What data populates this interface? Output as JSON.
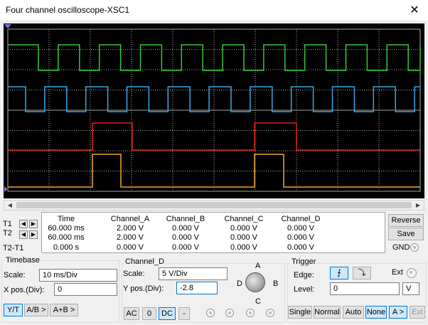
{
  "window": {
    "title": "Four channel oscilloscope-XSC1",
    "close_glyph": "✕"
  },
  "colors": {
    "ch_a": "#38c838",
    "ch_b": "#38a8e8",
    "ch_c": "#e82020",
    "ch_d": "#f0a830",
    "grid": "#dcdcdc"
  },
  "readout": {
    "headers": [
      "Time",
      "Channel_A",
      "Channel_B",
      "Channel_C",
      "Channel_D"
    ],
    "rows": [
      {
        "label": "T1",
        "time": "60.000 ms",
        "a": "2.000 V",
        "b": "0.000 V",
        "c": "0.000 V",
        "d": "0.000 V"
      },
      {
        "label": "T2",
        "time": "60.000 ms",
        "a": "2.000 V",
        "b": "0.000 V",
        "c": "0.000 V",
        "d": "0.000 V"
      },
      {
        "label": "T2-T1",
        "time": "0.000 s",
        "a": "0.000 V",
        "b": "0.000 V",
        "c": "0.000 V",
        "d": "0.000 V"
      }
    ]
  },
  "side": {
    "reverse": "Reverse",
    "save": "Save",
    "gnd": "GND"
  },
  "timebase": {
    "title": "Timebase",
    "scale_label": "Scale:",
    "scale_value": "10 ms/Div",
    "xpos_label": "X pos.(Div):",
    "xpos_value": "0",
    "modes": [
      "Y/T",
      "A/B >",
      "A+B >"
    ]
  },
  "channel": {
    "title": "Channel_D",
    "scale_label": "Scale:",
    "scale_value": "5  V/Div",
    "ypos_label": "Y pos.(Div):",
    "ypos_value": "-2.8",
    "coupling": [
      "AC",
      "0",
      "DC",
      "-"
    ],
    "knob_labels": {
      "a": "A",
      "b": "B",
      "c": "C",
      "d": "D"
    }
  },
  "trigger": {
    "title": "Trigger",
    "edge_label": "Edge:",
    "rise_glyph": "⨍",
    "fall_glyph": "⤵",
    "ext_label": "Ext",
    "level_label": "Level:",
    "level_value": "0",
    "level_unit": "V",
    "modes": [
      "Single",
      "Normal",
      "Auto",
      "None",
      "A >",
      "Ext"
    ]
  }
}
